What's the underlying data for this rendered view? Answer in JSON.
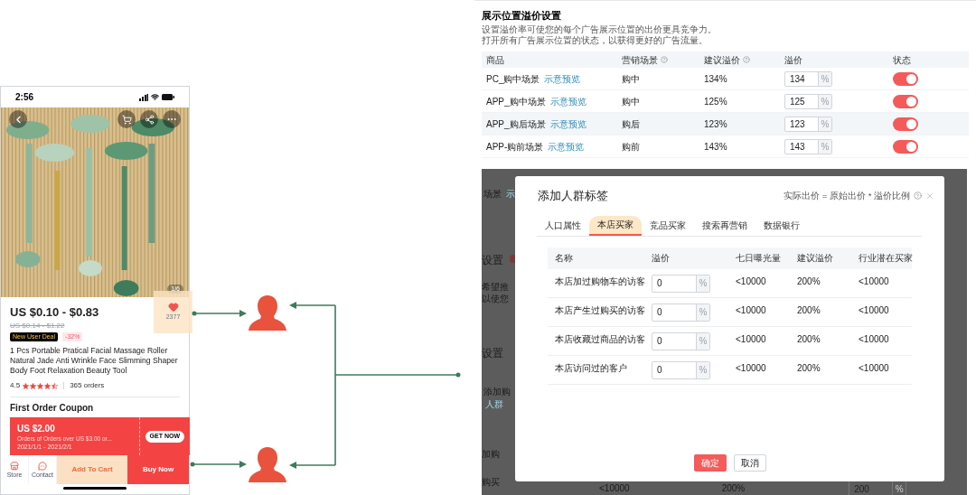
{
  "phone": {
    "time": "2:56",
    "image_counter": "1/6",
    "price": "US $0.10 - $0.83",
    "original_price": "US $0.14 - $1.22",
    "deal_badge": "New User Deal",
    "discount": "-32%",
    "wishlist_count": "2377",
    "product_title": "1 Pcs Portable Pratical Facial Massage Roller Natural Jade Anti Wrinkle Face Slimming Shaper Body Foot Relaxation Beauty Tool",
    "rating": "4.5",
    "stars": 4.5,
    "orders": "365 orders",
    "coupon_heading": "First Order Coupon",
    "coupon": {
      "amount": "US $2.00",
      "condition": "Orders of Orders over US $3.00 or...",
      "dates": "2021/1/1 - 2021/2/1",
      "button": "GET NOW"
    },
    "bottom_bar": [
      {
        "kind": "icon",
        "label": "Store"
      },
      {
        "kind": "icon",
        "label": "Contact"
      },
      {
        "kind": "secondary",
        "label": "Add To Cart"
      },
      {
        "kind": "primary",
        "label": "Buy Now"
      }
    ]
  },
  "placement_settings": {
    "title": "展示位置溢价设置",
    "description": [
      "设置溢价率可使您的每个广告展示位置的出价更具竞争力。",
      "打开所有广告展示位置的状态，以获得更好的广告流量。"
    ],
    "columns": [
      {
        "label": "商品",
        "help": false
      },
      {
        "label": "营销场景",
        "help": true
      },
      {
        "label": "建议溢价",
        "help": true
      },
      {
        "label": "溢价",
        "help": false
      },
      {
        "label": "状态",
        "help": false
      }
    ],
    "rows": [
      {
        "placement": "PC_购中场景",
        "preview_link": "示意预览",
        "scene": "购中",
        "suggested": "134%",
        "premium": "134",
        "unit": "%",
        "on": true,
        "highlighted": false
      },
      {
        "placement": "APP_购中场景",
        "preview_link": "示意预览",
        "scene": "购中",
        "suggested": "125%",
        "premium": "125",
        "unit": "%",
        "on": true,
        "highlighted": false
      },
      {
        "placement": "APP_购后场景",
        "preview_link": "示意预览",
        "scene": "购后",
        "suggested": "123%",
        "premium": "123",
        "unit": "%",
        "on": true,
        "highlighted": true
      },
      {
        "placement": "APP-购前场景",
        "preview_link": "示意预览",
        "scene": "购前",
        "suggested": "143%",
        "premium": "143",
        "unit": "%",
        "on": true,
        "highlighted": false
      }
    ]
  },
  "background_page": {
    "fragments": [
      {
        "kind": "text",
        "text": "场景"
      },
      {
        "kind": "link",
        "text": "示"
      },
      {
        "kind": "heading",
        "text": "设置"
      },
      {
        "kind": "text",
        "text": "希望推"
      },
      {
        "kind": "text",
        "text": "以使您"
      },
      {
        "kind": "heading",
        "text": "设置"
      },
      {
        "kind": "text",
        "text": "添加购"
      },
      {
        "kind": "link",
        "text": "人群"
      },
      {
        "kind": "text",
        "text": "加购"
      },
      {
        "kind": "text",
        "text": "购买"
      }
    ],
    "bottom_row": {
      "exposure": "<10000",
      "suggested": "200%",
      "premium": "200",
      "unit": "%"
    }
  },
  "dialog": {
    "title": "添加人群标签",
    "formula": "实际出价 = 原始出价 * 溢价比例",
    "tabs": [
      {
        "label": "人口属性",
        "selected": false
      },
      {
        "label": "本店买家",
        "selected": true
      },
      {
        "label": "竞品买家",
        "selected": false
      },
      {
        "label": "搜索再营销",
        "selected": false
      },
      {
        "label": "数据银行",
        "selected": false
      }
    ],
    "columns": [
      "名称",
      "溢价",
      "七日曝光量",
      "建议溢价",
      "行业潜在买家"
    ],
    "rows": [
      {
        "name": "本店加过购物车的访客",
        "premium": "0",
        "unit": "%",
        "exposure": "<10000",
        "suggested": "200%",
        "potential": "<10000"
      },
      {
        "name": "本店产生过购买的访客",
        "premium": "0",
        "unit": "%",
        "exposure": "<10000",
        "suggested": "200%",
        "potential": "<10000"
      },
      {
        "name": "本店收藏过商品的访客",
        "premium": "0",
        "unit": "%",
        "exposure": "<10000",
        "suggested": "200%",
        "potential": "<10000"
      },
      {
        "name": "本店访问过的客户",
        "premium": "0",
        "unit": "%",
        "exposure": "<10000",
        "suggested": "200%",
        "potential": "<10000"
      }
    ],
    "buttons": [
      {
        "kind": "primary",
        "label": "确定"
      },
      {
        "kind": "default",
        "label": "取消"
      }
    ]
  }
}
